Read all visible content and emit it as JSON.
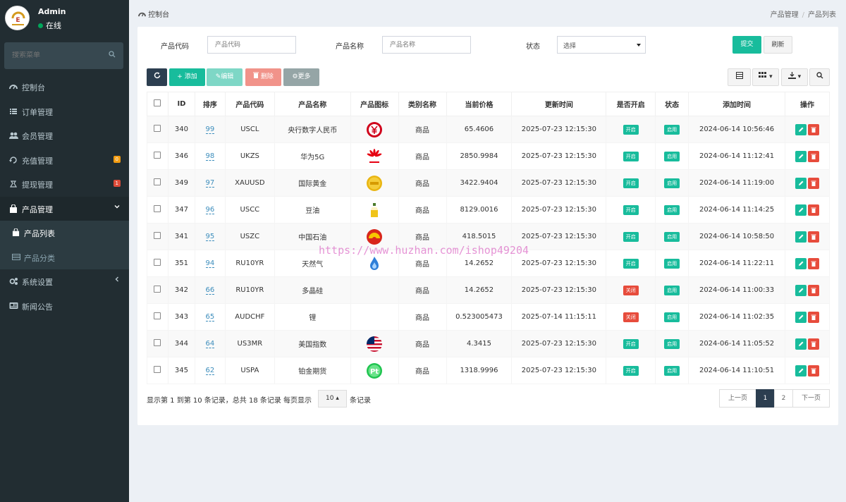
{
  "user": {
    "name": "Admin",
    "status": "在线"
  },
  "search": {
    "placeholder": "搜索菜单"
  },
  "menu": {
    "dashboard": "控制台",
    "orders": "订单管理",
    "members": "会员管理",
    "recharge": "充值管理",
    "recharge_badge": "0",
    "withdraw": "提现管理",
    "withdraw_badge": "1",
    "products": "产品管理",
    "product_list": "产品列表",
    "product_category": "产品分类",
    "settings": "系统设置",
    "news": "新闻公告"
  },
  "breadcrumb": {
    "left": "控制台",
    "parent": "产品管理",
    "sep": "/",
    "current": "产品列表"
  },
  "filters": {
    "code_label": "产品代码",
    "code_placeholder": "产品代码",
    "name_label": "产品名称",
    "name_placeholder": "产品名称",
    "status_label": "状态",
    "status_value": "选择",
    "submit": "提交",
    "reset": "刷新"
  },
  "toolbar": {
    "add": "添加",
    "edit": "编辑",
    "delete": "删除",
    "more": "更多"
  },
  "table": {
    "headers": [
      "ID",
      "排序",
      "产品代码",
      "产品名称",
      "产品图标",
      "类别名称",
      "当前价格",
      "更新时间",
      "是否开启",
      "状态",
      "添加时间",
      "操作"
    ],
    "rows": [
      {
        "id": "340",
        "sort": "99",
        "code": "USCL",
        "name": "央行数字人民币",
        "icon": "digital-rmb",
        "category": "商品",
        "price": "65.4606",
        "updated": "2025-07-23 12:15:30",
        "open": "开启",
        "status": "启用",
        "added": "2024-06-14 10:56:46"
      },
      {
        "id": "346",
        "sort": "98",
        "code": "UKZS",
        "name": "华为5G",
        "icon": "huawei",
        "category": "商品",
        "price": "2850.9984",
        "updated": "2025-07-23 12:15:30",
        "open": "开启",
        "status": "启用",
        "added": "2024-06-14 11:12:41"
      },
      {
        "id": "349",
        "sort": "97",
        "code": "XAUUSD",
        "name": "国际黄金",
        "icon": "gold",
        "category": "商品",
        "price": "3422.9404",
        "updated": "2025-07-23 12:15:30",
        "open": "开启",
        "status": "启用",
        "added": "2024-06-14 11:19:00"
      },
      {
        "id": "347",
        "sort": "96",
        "code": "USCC",
        "name": "豆油",
        "icon": "soybean-oil",
        "category": "商品",
        "price": "8129.0016",
        "updated": "2025-07-23 12:15:30",
        "open": "开启",
        "status": "启用",
        "added": "2024-06-14 11:14:25"
      },
      {
        "id": "341",
        "sort": "95",
        "code": "USZC",
        "name": "中国石油",
        "icon": "petrochina",
        "category": "商品",
        "price": "418.5015",
        "updated": "2025-07-23 12:15:30",
        "open": "开启",
        "status": "启用",
        "added": "2024-06-14 10:58:50"
      },
      {
        "id": "351",
        "sort": "94",
        "code": "RU10YR",
        "name": "天然气",
        "icon": "natural-gas",
        "category": "商品",
        "price": "14.2652",
        "updated": "2025-07-23 12:15:30",
        "open": "开启",
        "status": "启用",
        "added": "2024-06-14 11:22:11"
      },
      {
        "id": "342",
        "sort": "66",
        "code": "RU10YR",
        "name": "多晶硅",
        "icon": "",
        "category": "商品",
        "price": "14.2652",
        "updated": "2025-07-23 12:15:30",
        "open": "关闭",
        "status": "启用",
        "added": "2024-06-14 11:00:33"
      },
      {
        "id": "343",
        "sort": "65",
        "code": "AUDCHF",
        "name": "锂",
        "icon": "",
        "category": "商品",
        "price": "0.523005473",
        "updated": "2025-07-14 11:15:11",
        "open": "关闭",
        "status": "启用",
        "added": "2024-06-14 11:02:35"
      },
      {
        "id": "344",
        "sort": "64",
        "code": "US3MR",
        "name": "美国指数",
        "icon": "us-flag",
        "category": "商品",
        "price": "4.3415",
        "updated": "2025-07-23 12:15:30",
        "open": "开启",
        "status": "启用",
        "added": "2024-06-14 11:05:52"
      },
      {
        "id": "345",
        "sort": "62",
        "code": "USPA",
        "name": "铂金期货",
        "icon": "platinum",
        "category": "商品",
        "price": "1318.9996",
        "updated": "2025-07-23 12:15:30",
        "open": "开启",
        "status": "启用",
        "added": "2024-06-14 11:10:51"
      }
    ]
  },
  "footer": {
    "info": "显示第 1 到第 10 条记录，总共 18 条记录 每页显示",
    "page_size": "10",
    "suffix": "条记录",
    "prev": "上一页",
    "page1": "1",
    "page2": "2",
    "next": "下一页"
  },
  "watermark": "https://www.huzhan.com/ishop49204",
  "colors": {
    "sidebar": "#222d32",
    "primary": "#18bc9c",
    "danger": "#e74c3c",
    "dark": "#2c3e50"
  }
}
